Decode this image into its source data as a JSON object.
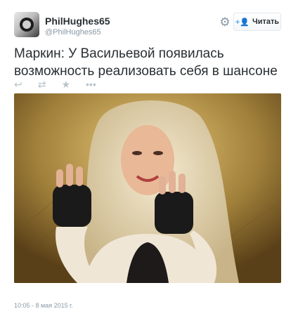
{
  "author": {
    "display_name": "PhilHughes65",
    "username": "@PhilHughes65"
  },
  "header": {
    "gear_icon": "gear-icon",
    "follow_label": "Читать",
    "follow_icon": "add-user-icon"
  },
  "tweet": {
    "text": "Маркин: У Васильевой появилась возможность реализовать себя в шансоне",
    "timestamp": "10:05 - 8 мая 2015 г."
  },
  "actions": [
    {
      "icon": "reply-icon"
    },
    {
      "icon": "retweet-icon"
    },
    {
      "icon": "favorite-star-icon"
    },
    {
      "icon": "more-dots-icon"
    }
  ],
  "colors": {
    "text": "#292f33",
    "muted": "#8899a6",
    "accent": "#55acee"
  }
}
